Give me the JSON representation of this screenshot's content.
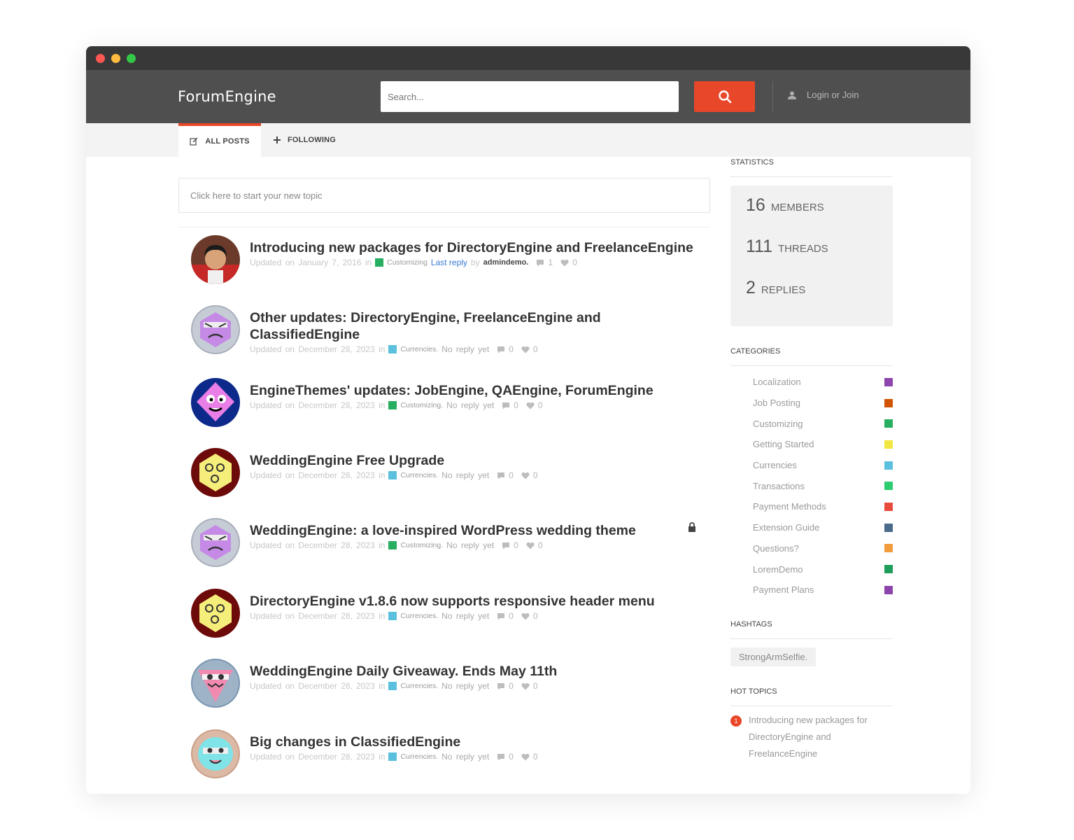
{
  "header": {
    "logo": "ForumEngine",
    "search_placeholder": "Search...",
    "login_label": "Login or Join"
  },
  "nav": {
    "tabs": [
      {
        "label": "ALL POSTS",
        "icon": "edit-icon",
        "active": true
      },
      {
        "label": "FOLLOWING",
        "icon": "plus-icon",
        "active": false
      }
    ]
  },
  "main": {
    "new_topic_placeholder": "Click here to start your new topic",
    "threads": [
      {
        "title_lines": [
          "Introducing new packages for DirectoryEngine and FreelanceEngine"
        ],
        "updated": "Updated on January 7, 2016 in",
        "category": "Customizing",
        "category_color": "#27ae60",
        "reply_text": "Last reply",
        "by": "by",
        "user": "admindemo.",
        "comments": "1",
        "likes": "0",
        "locked": false,
        "avatar": "photo"
      },
      {
        "title_lines": [
          "Other updates: DirectoryEngine, FreelanceEngine and",
          "ClassifiedEngine"
        ],
        "updated": "Updated on December 28, 2023 in",
        "category": "Currencies.",
        "category_color": "#5bc0de",
        "reply_text": "No reply yet",
        "comments": "0",
        "likes": "0",
        "locked": false,
        "avatar": "purple-angry"
      },
      {
        "title_lines": [
          "EngineThemes' updates: JobEngine, QAEngine, ForumEngine"
        ],
        "updated": "Updated on December 28, 2023 in",
        "category": "Customizing.",
        "category_color": "#27ae60",
        "reply_text": "No reply yet",
        "comments": "0",
        "likes": "0",
        "locked": false,
        "avatar": "blue-diamond"
      },
      {
        "title_lines": [
          "WeddingEngine Free Upgrade"
        ],
        "updated": "Updated on December 28, 2023 in",
        "category": "Currencies.",
        "category_color": "#5bc0de",
        "reply_text": "No reply yet",
        "comments": "0",
        "likes": "0",
        "locked": false,
        "avatar": "yellow-hex"
      },
      {
        "title_lines": [
          "WeddingEngine: a love-inspired WordPress wedding theme"
        ],
        "updated": "Updated on December 28, 2023 in",
        "category": "Customizing.",
        "category_color": "#27ae60",
        "reply_text": "No reply yet",
        "comments": "0",
        "likes": "0",
        "locked": true,
        "avatar": "purple-angry"
      },
      {
        "title_lines": [
          "DirectoryEngine v1.8.6 now supports responsive header menu"
        ],
        "updated": "Updated on December 28, 2023 in",
        "category": "Currencies.",
        "category_color": "#5bc0de",
        "reply_text": "No reply yet",
        "comments": "0",
        "likes": "0",
        "locked": false,
        "avatar": "yellow-hex"
      },
      {
        "title_lines": [
          "WeddingEngine Daily Giveaway. Ends May 11th"
        ],
        "updated": "Updated on December 28, 2023 in",
        "category": "Currencies.",
        "category_color": "#5bc0de",
        "reply_text": "No reply yet",
        "comments": "0",
        "likes": "0",
        "locked": false,
        "avatar": "pink-triangle"
      },
      {
        "title_lines": [
          "Big changes in ClassifiedEngine"
        ],
        "updated": "Updated on December 28, 2023 in",
        "category": "Currencies.",
        "category_color": "#5bc0de",
        "reply_text": "No reply yet",
        "comments": "0",
        "likes": "0",
        "locked": false,
        "avatar": "cyan-face"
      }
    ]
  },
  "sidebar": {
    "statistics_heading": "STATISTICS",
    "stats": [
      {
        "num": "16",
        "label": "MEMBERS"
      },
      {
        "num": "111",
        "label": "THREADS"
      },
      {
        "num": "2",
        "label": "REPLIES"
      }
    ],
    "categories_heading": "CATEGORIES",
    "categories": [
      {
        "name": "Localization",
        "color": "#8e44ad"
      },
      {
        "name": "Job Posting",
        "color": "#d35400"
      },
      {
        "name": "Customizing",
        "color": "#27ae60"
      },
      {
        "name": "Getting Started",
        "color": "#f1e740"
      },
      {
        "name": "Currencies",
        "color": "#5bc0de"
      },
      {
        "name": "Transactions",
        "color": "#2ecc71"
      },
      {
        "name": "Payment Methods",
        "color": "#e74c3c"
      },
      {
        "name": "Extension Guide",
        "color": "#4a6b8a"
      },
      {
        "name": "Questions?",
        "color": "#f39c3c"
      },
      {
        "name": "LoremDemo",
        "color": "#1e9e5a"
      },
      {
        "name": "Payment Plans",
        "color": "#8e44ad"
      }
    ],
    "hashtags_heading": "HASHTAGS",
    "hashtag": "StrongArmSelfie.",
    "hot_heading": "HOT TOPICS",
    "hot_topic": {
      "rank": "1",
      "text": "Introducing new packages for DirectoryEngine and FreelanceEngine"
    }
  },
  "colors": {
    "accent": "#e8472a",
    "header_bg": "#4f4f4f",
    "titlebar": "#383838"
  }
}
